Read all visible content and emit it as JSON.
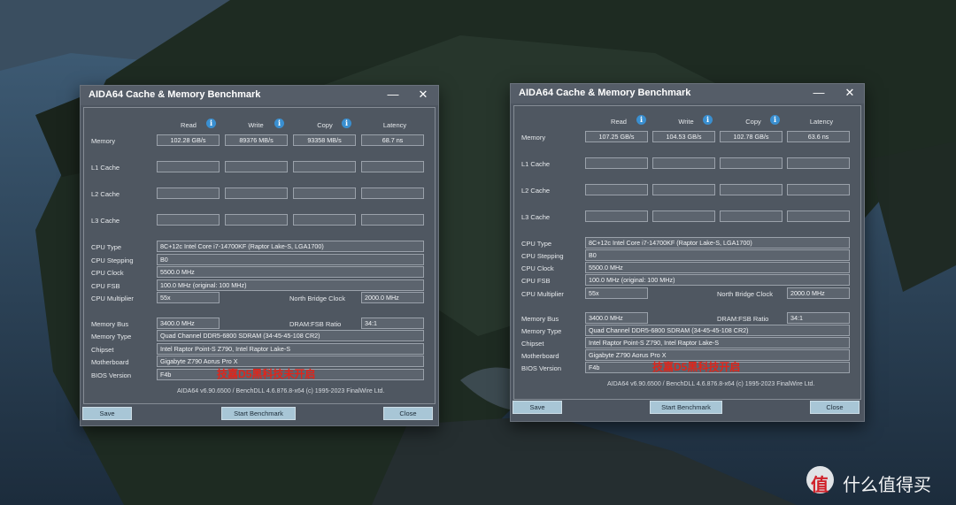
{
  "windows": [
    {
      "title": "AIDA64 Cache & Memory Benchmark",
      "minimize": "—",
      "close_glyph": "✕",
      "headers": {
        "read": "Read",
        "write": "Write",
        "copy": "Copy",
        "latency": "Latency"
      },
      "info_glyph": "i",
      "rows": {
        "memory": {
          "label": "Memory",
          "read": "102.28 GB/s",
          "write": "89376 MB/s",
          "copy": "93358 MB/s",
          "latency": "68.7 ns"
        },
        "l1": {
          "label": "L1 Cache",
          "read": "",
          "write": "",
          "copy": "",
          "latency": ""
        },
        "l2": {
          "label": "L2 Cache",
          "read": "",
          "write": "",
          "copy": "",
          "latency": ""
        },
        "l3": {
          "label": "L3 Cache",
          "read": "",
          "write": "",
          "copy": "",
          "latency": ""
        }
      },
      "cpu": {
        "type_label": "CPU Type",
        "type": "8C+12c Intel Core i7-14700KF  (Raptor Lake-S, LGA1700)",
        "stepping_label": "CPU Stepping",
        "stepping": "B0",
        "clock_label": "CPU Clock",
        "clock": "5500.0 MHz",
        "fsb_label": "CPU FSB",
        "fsb": "100.0 MHz  (original: 100 MHz)",
        "multiplier_label": "CPU Multiplier",
        "multiplier": "55x",
        "nb_clock_label": "North Bridge Clock",
        "nb_clock": "2000.0 MHz"
      },
      "mem": {
        "bus_label": "Memory Bus",
        "bus": "3400.0 MHz",
        "ratio_label": "DRAM:FSB Ratio",
        "ratio": "34:1",
        "type_label": "Memory Type",
        "type": "Quad Channel DDR5-6800 SDRAM  (34-45-45-108 CR2)",
        "chipset_label": "Chipset",
        "chipset": "Intel Raptor Point-S Z790, Intel Raptor Lake-S",
        "motherboard_label": "Motherboard",
        "motherboard": "Gigabyte Z790 Aorus Pro X",
        "bios_label": "BIOS Version",
        "bios": "F4b"
      },
      "annotation": "技嘉D5黑科技未开启",
      "footer": "AIDA64 v6.90.6500 / BenchDLL 4.6.876.8-x64  (c) 1995-2023 FinalWire Ltd.",
      "buttons": {
        "save": "Save",
        "start": "Start Benchmark",
        "close": "Close"
      }
    },
    {
      "title": "AIDA64 Cache & Memory Benchmark",
      "minimize": "—",
      "close_glyph": "✕",
      "headers": {
        "read": "Read",
        "write": "Write",
        "copy": "Copy",
        "latency": "Latency"
      },
      "info_glyph": "i",
      "rows": {
        "memory": {
          "label": "Memory",
          "read": "107.25 GB/s",
          "write": "104.53 GB/s",
          "copy": "102.78 GB/s",
          "latency": "63.6 ns"
        },
        "l1": {
          "label": "L1 Cache",
          "read": "",
          "write": "",
          "copy": "",
          "latency": ""
        },
        "l2": {
          "label": "L2 Cache",
          "read": "",
          "write": "",
          "copy": "",
          "latency": ""
        },
        "l3": {
          "label": "L3 Cache",
          "read": "",
          "write": "",
          "copy": "",
          "latency": ""
        }
      },
      "cpu": {
        "type_label": "CPU Type",
        "type": "8C+12c Intel Core i7-14700KF  (Raptor Lake-S, LGA1700)",
        "stepping_label": "CPU Stepping",
        "stepping": "B0",
        "clock_label": "CPU Clock",
        "clock": "5500.0 MHz",
        "fsb_label": "CPU FSB",
        "fsb": "100.0 MHz  (original: 100 MHz)",
        "multiplier_label": "CPU Multiplier",
        "multiplier": "55x",
        "nb_clock_label": "North Bridge Clock",
        "nb_clock": "2000.0 MHz"
      },
      "mem": {
        "bus_label": "Memory Bus",
        "bus": "3400.0 MHz",
        "ratio_label": "DRAM:FSB Ratio",
        "ratio": "34:1",
        "type_label": "Memory Type",
        "type": "Quad Channel DDR5-6800 SDRAM  (34-45-45-108 CR2)",
        "chipset_label": "Chipset",
        "chipset": "Intel Raptor Point-S Z790, Intel Raptor Lake-S",
        "motherboard_label": "Motherboard",
        "motherboard": "Gigabyte Z790 Aorus Pro X",
        "bios_label": "BIOS Version",
        "bios": "F4b"
      },
      "annotation": "技嘉D5黑科技开启",
      "footer": "AIDA64 v6.90.6500 / BenchDLL 4.6.876.8-x64  (c) 1995-2023 FinalWire Ltd.",
      "buttons": {
        "save": "Save",
        "start": "Start Benchmark",
        "close": "Close"
      }
    }
  ],
  "watermark": {
    "text": "什么值得买",
    "logo_glyph": "值"
  },
  "colors": {
    "annotation_red": "#e0251b",
    "button_bg": "#a8c6d6",
    "info_blue": "#3a8fd0",
    "window_bg": "#4d5560"
  }
}
